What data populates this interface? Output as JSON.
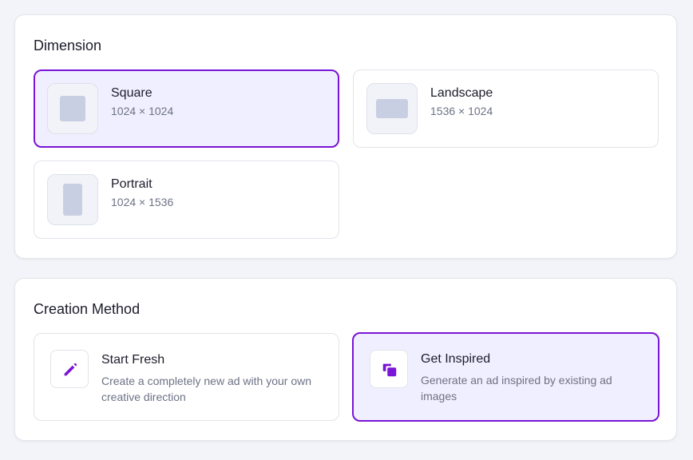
{
  "dimension": {
    "title": "Dimension",
    "options": [
      {
        "label": "Square",
        "size": "1024 × 1024",
        "selected": true
      },
      {
        "label": "Landscape",
        "size": "1536 × 1024",
        "selected": false
      },
      {
        "label": "Portrait",
        "size": "1024 × 1536",
        "selected": false
      }
    ]
  },
  "creation_method": {
    "title": "Creation Method",
    "options": [
      {
        "label": "Start Fresh",
        "description": "Create a completely new ad with your own creative direction",
        "icon": "pencil-icon",
        "selected": false
      },
      {
        "label": "Get Inspired",
        "description": "Generate an ad inspired by existing ad images",
        "icon": "copy-icon",
        "selected": true
      }
    ]
  },
  "colors": {
    "accent": "#7a14d6",
    "selected_bg": "#f0efff",
    "page_bg": "#f3f4f9",
    "muted_text": "#6d7285"
  }
}
